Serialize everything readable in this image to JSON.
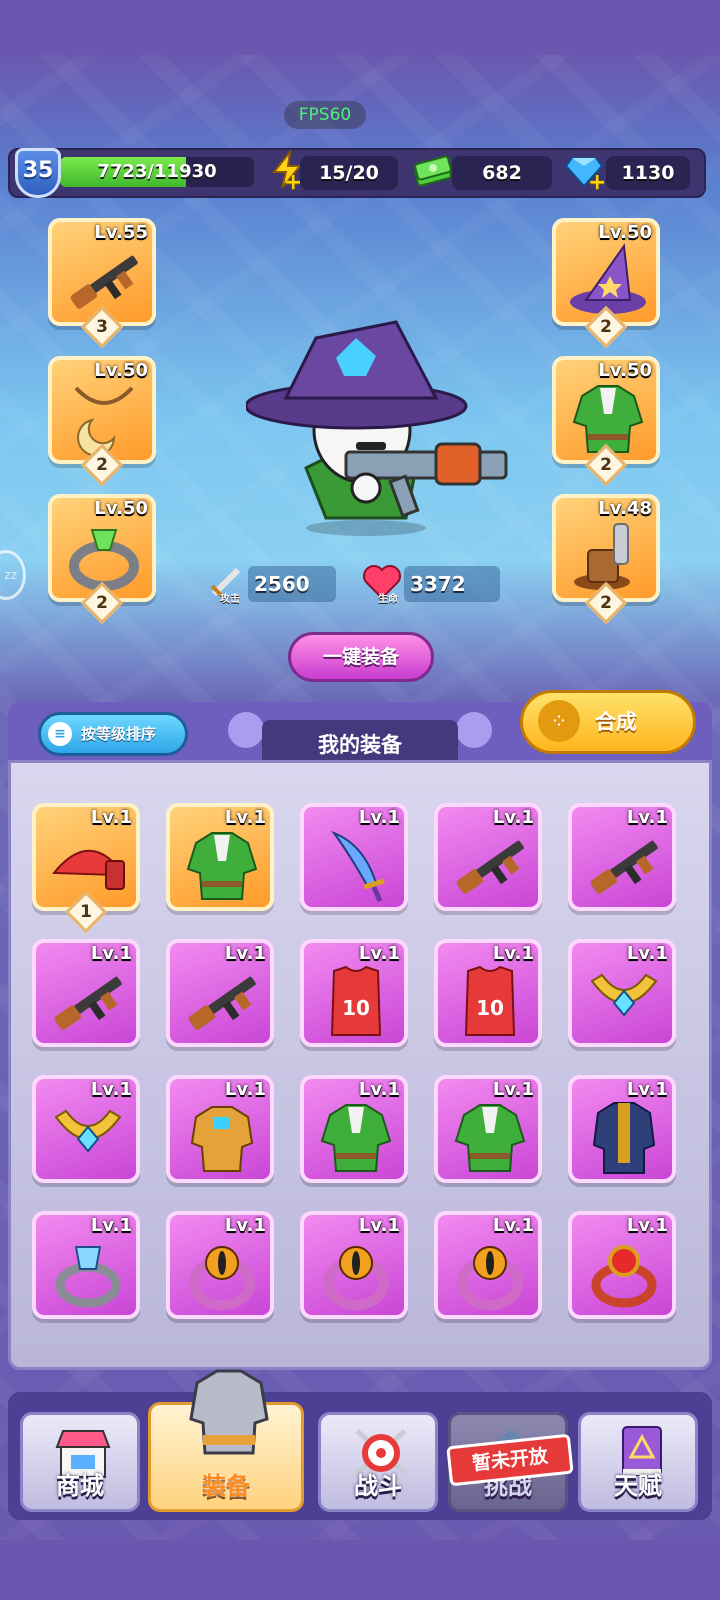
{
  "fps": "FPS60",
  "player": {
    "level": "35",
    "xp_text": "7723/11930",
    "xp_progress": 0.647
  },
  "resources": {
    "energy": "15/20",
    "cash": "682",
    "gems": "1130"
  },
  "equipped_left": [
    {
      "level": "Lv.55",
      "stars": "3",
      "item": "rifle-icon"
    },
    {
      "level": "Lv.50",
      "stars": "2",
      "item": "necklace-icon"
    },
    {
      "level": "Lv.50",
      "stars": "2",
      "item": "ring-icon"
    }
  ],
  "equipped_right": [
    {
      "level": "Lv.50",
      "stars": "2",
      "item": "wizard-hat-icon"
    },
    {
      "level": "Lv.50",
      "stars": "2",
      "item": "green-coat-icon"
    },
    {
      "level": "Lv.48",
      "stars": "2",
      "item": "boots-icon"
    }
  ],
  "stats": {
    "attack_value": "2560",
    "attack_label": "攻击",
    "hp_value": "3372",
    "hp_label": "生命"
  },
  "buttons": {
    "equip_all": "一键装备",
    "sort": "按等级排序",
    "synthesize": "合成"
  },
  "inventory": {
    "title": "我的装备",
    "items": [
      {
        "level": "Lv.1",
        "rarity": "orange",
        "item": "cap-icon",
        "stars": "1"
      },
      {
        "level": "Lv.1",
        "rarity": "orange",
        "item": "green-coat-icon"
      },
      {
        "level": "Lv.1",
        "rarity": "purple",
        "item": "dagger-icon"
      },
      {
        "level": "Lv.1",
        "rarity": "purple",
        "item": "rifle-icon"
      },
      {
        "level": "Lv.1",
        "rarity": "purple",
        "item": "rifle-icon"
      },
      {
        "level": "Lv.1",
        "rarity": "purple",
        "item": "rifle-icon"
      },
      {
        "level": "Lv.1",
        "rarity": "purple",
        "item": "rifle-icon"
      },
      {
        "level": "Lv.1",
        "rarity": "purple",
        "item": "jersey-icon"
      },
      {
        "level": "Lv.1",
        "rarity": "purple",
        "item": "jersey-icon"
      },
      {
        "level": "Lv.1",
        "rarity": "purple",
        "item": "gem-amulet-icon"
      },
      {
        "level": "Lv.1",
        "rarity": "purple",
        "item": "gem-amulet-icon"
      },
      {
        "level": "Lv.1",
        "rarity": "purple",
        "item": "gold-armor-icon"
      },
      {
        "level": "Lv.1",
        "rarity": "purple",
        "item": "green-coat-icon"
      },
      {
        "level": "Lv.1",
        "rarity": "purple",
        "item": "green-coat-icon"
      },
      {
        "level": "Lv.1",
        "rarity": "purple",
        "item": "dark-coat-icon"
      },
      {
        "level": "Lv.1",
        "rarity": "purple",
        "item": "crystal-ring-icon"
      },
      {
        "level": "Lv.1",
        "rarity": "purple",
        "item": "eye-ring-icon"
      },
      {
        "level": "Lv.1",
        "rarity": "purple",
        "item": "eye-ring-icon"
      },
      {
        "level": "Lv.1",
        "rarity": "purple",
        "item": "eye-ring-icon"
      },
      {
        "level": "Lv.1",
        "rarity": "purple",
        "item": "ruby-ring-icon"
      }
    ]
  },
  "nav": [
    {
      "label": "商城",
      "icon": "shop-icon"
    },
    {
      "label": "装备",
      "icon": "armor-icon"
    },
    {
      "label": "战斗",
      "icon": "target-icon"
    },
    {
      "label": "挑战",
      "icon": "challenge-icon"
    },
    {
      "label": "天赋",
      "icon": "talent-book-icon"
    }
  ],
  "locked_tag": "暂未开放",
  "colors": {
    "orange_rarity": "#ff9a2a",
    "purple_rarity": "#c946d6",
    "accent_yellow": "#ffb51e",
    "xp_green": "#3fb82c"
  }
}
